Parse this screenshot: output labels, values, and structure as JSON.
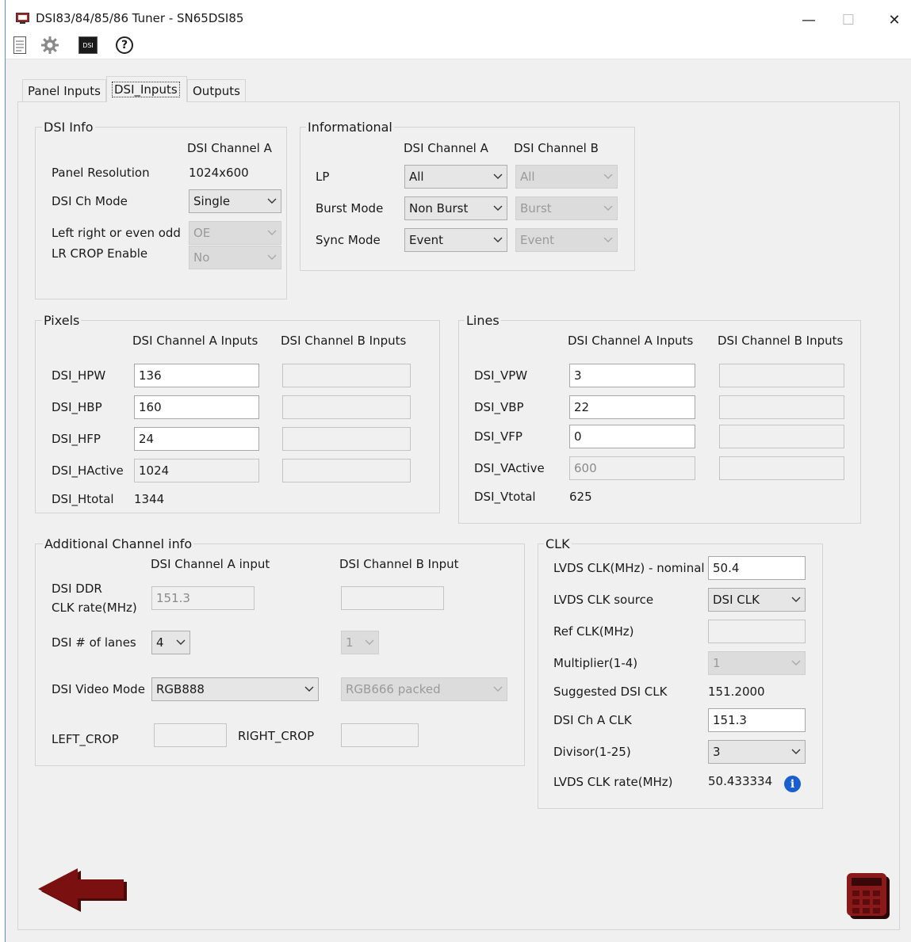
{
  "window": {
    "title": "DSI83/84/85/86 Tuner - SN65DSI85",
    "minimize": "—",
    "maximize": "☐",
    "close": "✕"
  },
  "toolbar": {
    "icons": [
      "document-icon",
      "gear-icon",
      "dsi-icon",
      "help-icon"
    ],
    "dsi_icon_text": "DSI",
    "help_icon_text": "?"
  },
  "tabs": [
    "Panel Inputs",
    "DSI_Inputs",
    "Outputs"
  ],
  "dsi_info": {
    "legend": "DSI Info",
    "col_header": "DSI Channel A",
    "panel_resolution_label": "Panel Resolution",
    "panel_resolution": "1024x600",
    "ch_mode_label": "DSI Ch Mode",
    "ch_mode": "Single",
    "lr_label": "Left right or even odd",
    "lr_value": "OE",
    "crop_label": "LR CROP Enable",
    "crop_value": "No"
  },
  "informational": {
    "legend": "Informational",
    "col_a": "DSI Channel A",
    "col_b": "DSI Channel B",
    "rows": [
      {
        "label": "LP",
        "a": "All",
        "b": "All"
      },
      {
        "label": "Burst Mode",
        "a": "Non Burst",
        "b": "Burst"
      },
      {
        "label": "Sync Mode",
        "a": "Event",
        "b": "Event"
      }
    ]
  },
  "pixels": {
    "legend": "Pixels",
    "col_a": "DSI Channel A Inputs",
    "col_b": "DSI Channel B Inputs",
    "rows": [
      {
        "label": "DSI_HPW",
        "a": "136"
      },
      {
        "label": "DSI_HBP",
        "a": "160"
      },
      {
        "label": "DSI_HFP",
        "a": "24"
      },
      {
        "label": "DSI_HActive",
        "a": "1024"
      }
    ],
    "total_label": "DSI_Htotal",
    "total": "1344"
  },
  "lines": {
    "legend": "Lines",
    "col_a": "DSI Channel A Inputs",
    "col_b": "DSI Channel B Inputs",
    "rows": [
      {
        "label": "DSI_VPW",
        "a": "3"
      },
      {
        "label": "DSI_VBP",
        "a": "22"
      },
      {
        "label": "DSI_VFP",
        "a": "0"
      },
      {
        "label": "DSI_VActive",
        "a": "600"
      }
    ],
    "total_label": "DSI_Vtotal",
    "total": "625"
  },
  "additional": {
    "legend": "Additional Channel info",
    "col_a": "DSI Channel A input",
    "col_b": "DSI Channel B Input",
    "ddr_label_1": "DSI DDR",
    "ddr_label_2": "CLK rate(MHz)",
    "ddr_a": "151.3",
    "lanes_label": "DSI # of lanes",
    "lanes_a": "4",
    "lanes_b": "1",
    "video_label": "DSI Video Mode",
    "video_a": "RGB888",
    "video_b": "RGB666 packed",
    "left_crop_label": "LEFT_CROP",
    "right_crop_label": "RIGHT_CROP"
  },
  "clk": {
    "legend": "CLK",
    "nominal_label": "LVDS CLK(MHz) - nominal",
    "nominal": "50.4",
    "source_label": "LVDS CLK source",
    "source": "DSI CLK",
    "ref_label": "Ref CLK(MHz)",
    "mult_label": "Multiplier(1-4)",
    "mult": "1",
    "suggested_label": "Suggested DSI CLK",
    "suggested": "151.2000",
    "cha_label": "DSI Ch A CLK",
    "cha": "151.3",
    "divisor_label": "Divisor(1-25)",
    "divisor": "3",
    "rate_label": "LVDS CLK rate(MHz)",
    "rate": "50.433334",
    "info_icon_text": "i"
  },
  "colors": {
    "back_arrow": "#7a1010",
    "calculator": "#8a1a1a",
    "info_icon": "#1a5fd0",
    "window_border": "#5b8fc9"
  }
}
